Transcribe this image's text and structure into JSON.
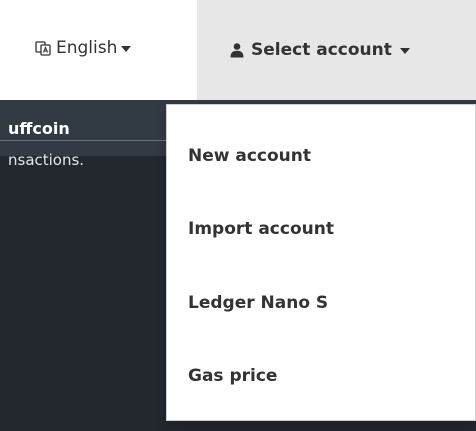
{
  "navbar": {
    "language": {
      "icon": "language-icon",
      "label": "English"
    },
    "account": {
      "icon": "user-icon",
      "label": "Select account"
    }
  },
  "background": {
    "token_name": "uffcoin",
    "token_desc": "nsactions."
  },
  "dropdown": {
    "items": [
      {
        "label": "New account"
      },
      {
        "label": "Import account"
      },
      {
        "label": "Ledger Nano S"
      },
      {
        "label": "Gas price"
      }
    ]
  },
  "colors": {
    "navbar_bg": "#ffffff",
    "account_toggle_bg": "#e7e7e7",
    "dark_panel_bg": "#22282e",
    "dark_header_bg": "#323a43",
    "menu_bg": "#ffffff",
    "text": "#333333"
  }
}
